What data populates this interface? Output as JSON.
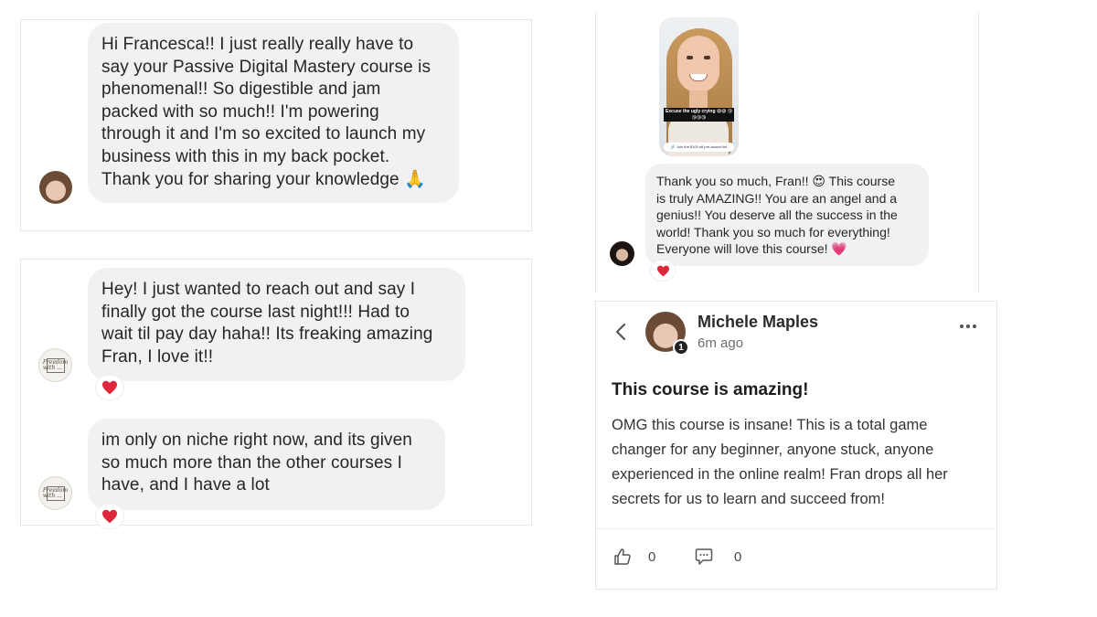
{
  "chat1": {
    "message": "Hi Francesca!! I just really really have to\nsay your Passive Digital Mastery course is\nphenomenal!! So digestible and jam\npacked with so much!! I'm powering\nthrough it and I'm so excited to launch my\nbusiness with this in my back pocket.\nThank you for sharing your knowledge 🙏"
  },
  "chat2": {
    "message_1": "Hey! I just wanted to reach out and say I\nfinally got the course last night!!! Had to\nwait til pay day haha!! Its freaking amazing\nFran, I love it!!",
    "message_2": "im only on niche right now, and its given\nso much more than the other courses I\nhave, and I have a lot",
    "reaction": "❤️",
    "avatar_logo_text": "Freedom with ..."
  },
  "chat3": {
    "story_caption": "Excuse the ugly crying 😅😅 😘😘😘😘",
    "story_pill": "🔗 Join the $100 off pre-launch list",
    "message": "Thank you so much, Fran!! 😍 This course\nis truly AMAZING!! You are an angel and a\ngenius!! You deserve all the success in the\nworld!  Thank you so much for everything!\nEveryone will love this course! 💗",
    "reaction": "❤️"
  },
  "post": {
    "author": "Michele Maples",
    "time": "6m ago",
    "rank": "1",
    "title": "This course is amazing!",
    "body": "OMG this course is insane! This is a total game\nchanger for any beginner, anyone stuck, anyone\nexperienced in the online realm! Fran drops all her\nsecrets for us to learn and succeed from!",
    "likes": "0",
    "comments": "0",
    "icons": [
      "chevron-left-icon",
      "more-icon",
      "thumbs-up-icon",
      "comment-icon"
    ]
  },
  "colors": {
    "bubble": "#f1f1f3",
    "heart": "#e0283d",
    "border": "#e6e6e6"
  }
}
